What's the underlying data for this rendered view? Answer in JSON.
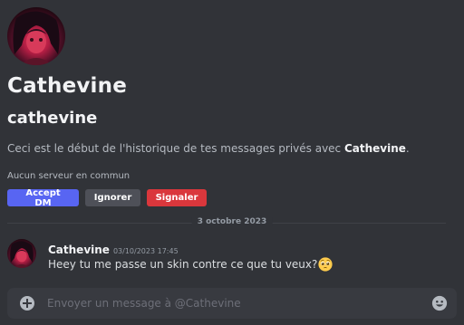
{
  "profile": {
    "display_name": "Cathevine",
    "username": "cathevine",
    "intro_prefix": "Ceci est le début de l'historique de tes messages privés avec ",
    "intro_name": "Cathevine",
    "intro_suffix": ".",
    "mutual_servers": "Aucun serveur en commun"
  },
  "actions": {
    "accept_label": "Accept DM",
    "ignore_label": "Ignorer",
    "report_label": "Signaler"
  },
  "date_divider": "3 octobre 2023",
  "message": {
    "author": "Cathevine",
    "timestamp": "03/10/2023 17:45",
    "text": "Heey tu me passe un skin contre ce que tu veux?",
    "emoji": "pleading-face-emoji"
  },
  "composer": {
    "placeholder": "Envoyer un message à @Cathevine",
    "attach_icon": "plus-circle-icon",
    "emoji_icon": "emoji-picker-icon"
  },
  "colors": {
    "background": "#313338",
    "accept": "#5865f2",
    "ignore": "#4e5058",
    "report": "#da373c"
  }
}
